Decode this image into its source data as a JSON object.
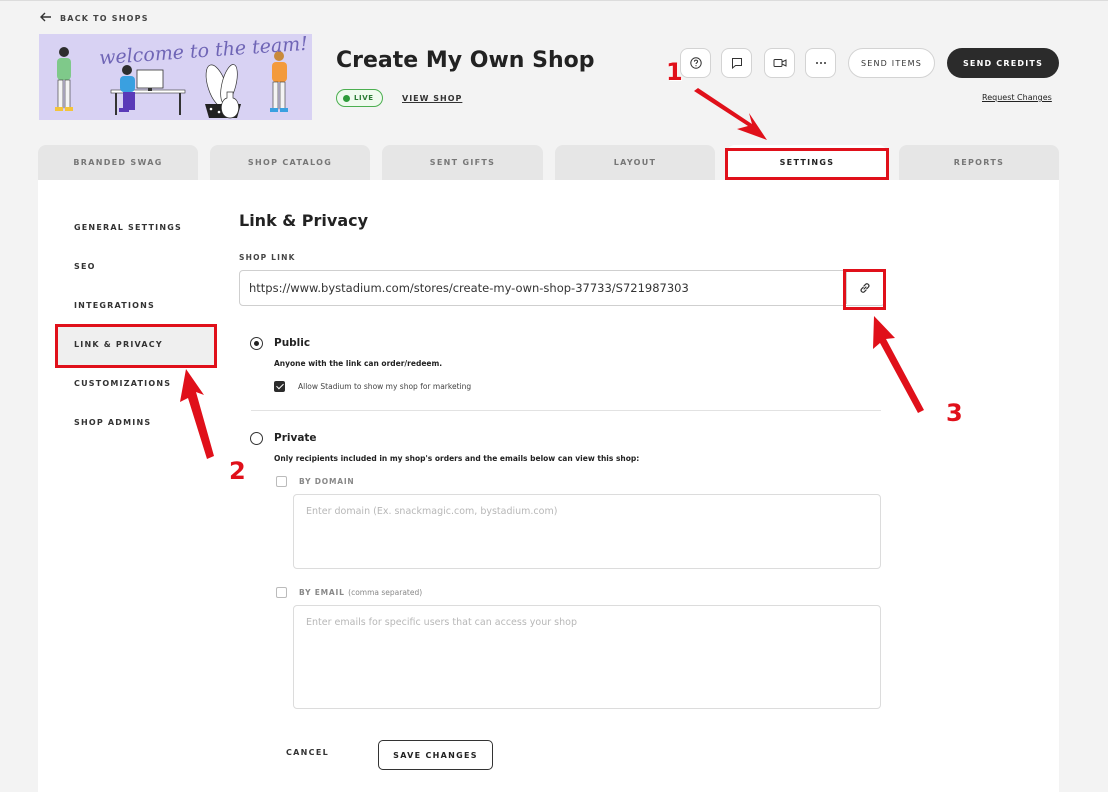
{
  "nav": {
    "back_label": "BACK TO SHOPS"
  },
  "banner": {
    "text": "welcome to the team!"
  },
  "shop": {
    "title": "Create My Own Shop",
    "status": "LIVE",
    "view_shop": "VIEW SHOP"
  },
  "actions": {
    "send_items": "SEND ITEMS",
    "send_credits": "SEND CREDITS",
    "request_changes": "Request Changes"
  },
  "tabs": [
    {
      "label": "BRANDED SWAG"
    },
    {
      "label": "SHOP CATALOG"
    },
    {
      "label": "SENT GIFTS"
    },
    {
      "label": "LAYOUT"
    },
    {
      "label": "SETTINGS",
      "active": true
    },
    {
      "label": "REPORTS"
    }
  ],
  "sidebar": {
    "items": [
      {
        "label": "GENERAL SETTINGS"
      },
      {
        "label": "SEO"
      },
      {
        "label": "INTEGRATIONS"
      },
      {
        "label": "LINK & PRIVACY",
        "active": true
      },
      {
        "label": "CUSTOMIZATIONS"
      },
      {
        "label": "SHOP ADMINS"
      }
    ]
  },
  "main": {
    "title": "Link & Privacy",
    "shop_link_label": "SHOP LINK",
    "shop_link_value": "https://www.bystadium.com/stores/create-my-own-shop-37733/S721987303",
    "public": {
      "title": "Public",
      "desc": "Anyone with the link can order/redeem.",
      "marketing_label": "Allow Stadium to show my shop for marketing",
      "marketing_checked": true,
      "selected": true
    },
    "private": {
      "title": "Private",
      "desc": "Only recipients included in my shop's orders and the emails below can view this shop:",
      "by_domain_label": "BY DOMAIN",
      "domain_placeholder": "Enter domain (Ex. snackmagic.com, bystadium.com)",
      "by_email_label": "BY EMAIL",
      "by_email_sub": "(comma separated)",
      "email_placeholder": "Enter emails for specific users that can access your shop"
    },
    "cancel_label": "CANCEL",
    "save_label": "SAVE CHANGES"
  },
  "annotations": {
    "n1": "1",
    "n2": "2",
    "n3": "3"
  },
  "colors": {
    "annotation": "#e0101a",
    "dark_button": "#2b2b2b",
    "live_green": "#2e9b3a",
    "banner_bg": "#d8d2f3"
  }
}
